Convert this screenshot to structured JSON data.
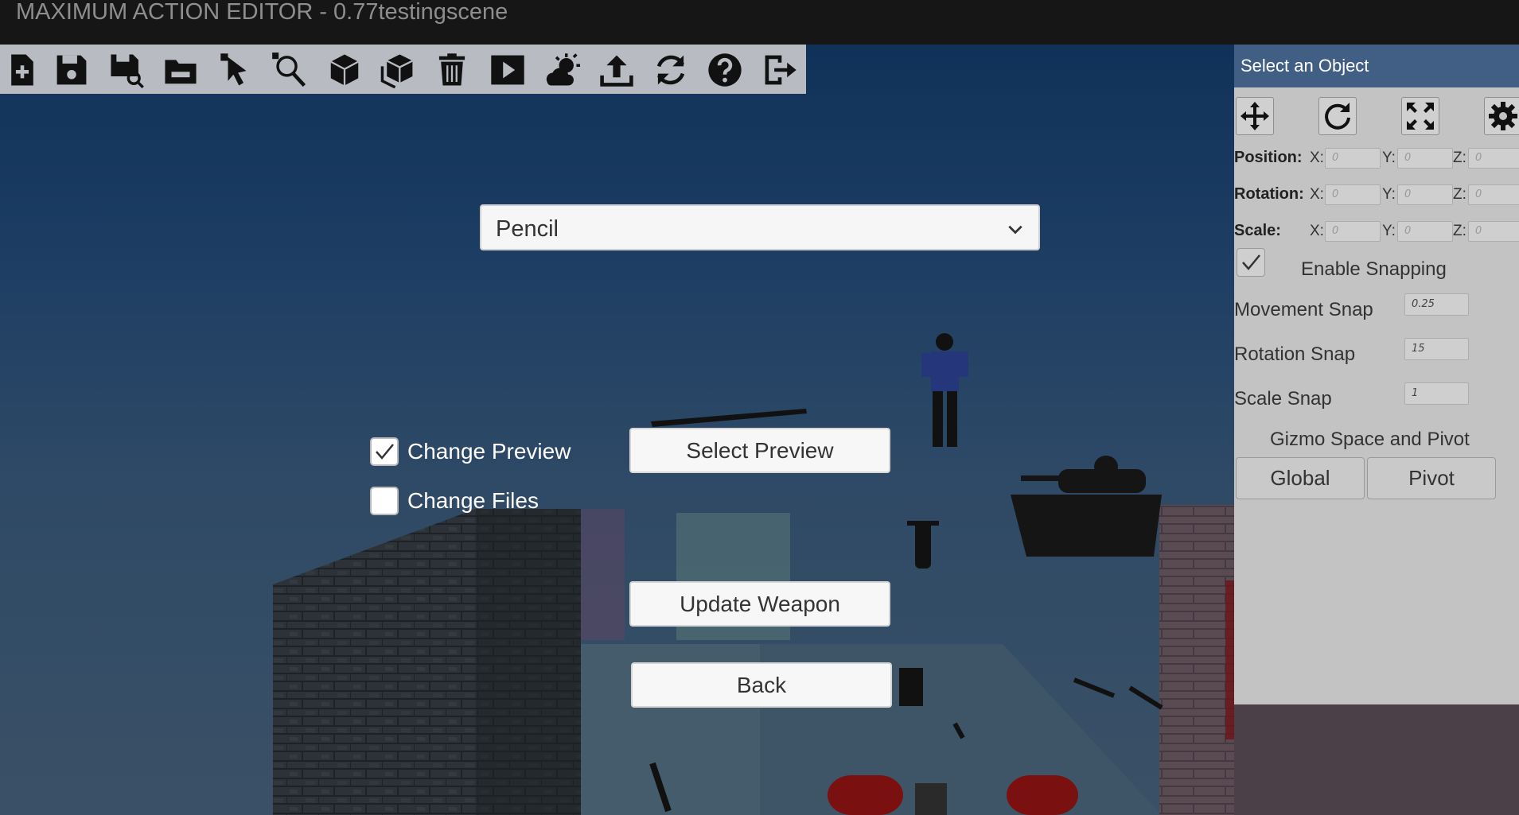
{
  "window": {
    "title": "MAXIMUM ACTION EDITOR - 0.77testingscene"
  },
  "toolbar": {
    "tools": [
      {
        "icon": "new-file-icon"
      },
      {
        "icon": "save-icon"
      },
      {
        "icon": "save-as-icon"
      },
      {
        "icon": "open-folder-icon"
      },
      {
        "icon": "select-cursor-icon"
      },
      {
        "icon": "zoom-select-icon"
      },
      {
        "icon": "cube-icon"
      },
      {
        "icon": "cube-group-icon"
      },
      {
        "icon": "trash-icon"
      },
      {
        "icon": "play-icon"
      },
      {
        "icon": "weather-icon"
      },
      {
        "icon": "upload-icon"
      },
      {
        "icon": "refresh-icon"
      },
      {
        "icon": "help-icon"
      },
      {
        "icon": "exit-icon"
      }
    ]
  },
  "weapon_dialog": {
    "weapon_select": {
      "value": "Pencil"
    },
    "change_preview": {
      "label": "Change Preview",
      "checked": true
    },
    "change_files": {
      "label": "Change Files",
      "checked": false
    },
    "select_preview_label": "Select Preview",
    "update_weapon_label": "Update Weapon",
    "back_label": "Back"
  },
  "inspector": {
    "header": "Select an Object",
    "gizmo_tools": [
      {
        "icon": "move-icon"
      },
      {
        "icon": "rotate-icon"
      },
      {
        "icon": "scale-icon"
      },
      {
        "icon": "settings-icon"
      }
    ],
    "transform": {
      "position": {
        "label": "Position:",
        "x": "0",
        "y": "0",
        "z": "0"
      },
      "rotation": {
        "label": "Rotation:",
        "x": "0",
        "y": "0",
        "z": "0"
      },
      "scale": {
        "label": "Scale:",
        "x": "0",
        "y": "0",
        "z": "0"
      },
      "axis_x": "X:",
      "axis_y": "Y:",
      "axis_z": "Z:"
    },
    "snapping": {
      "enable_label": "Enable Snapping",
      "enabled": true,
      "movement_label": "Movement Snap",
      "movement_value": "0.25",
      "rotation_label": "Rotation Snap",
      "rotation_value": "15",
      "scale_label": "Scale Snap",
      "scale_value": "1"
    },
    "gizmo_space_label": "Gizmo Space and Pivot",
    "global_label": "Global",
    "pivot_label": "Pivot"
  }
}
